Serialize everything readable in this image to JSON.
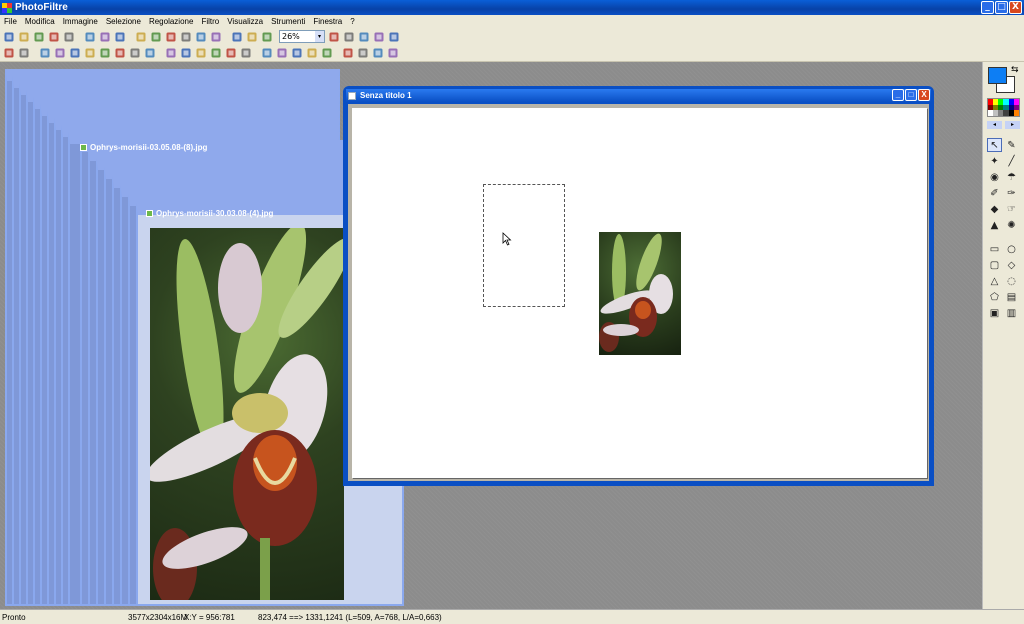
{
  "app": {
    "title": "PhotoFiltre"
  },
  "window_buttons": {
    "minimize": "_",
    "maximize": "□",
    "close": "X"
  },
  "menu": [
    "File",
    "Modifica",
    "Immagine",
    "Selezione",
    "Regolazione",
    "Filtro",
    "Visualizza",
    "Strumenti",
    "Finestra",
    "?"
  ],
  "toolbar": {
    "zoom_value": "26%",
    "zoom_arrow": "▾",
    "row1_icons": [
      "new-file-icon",
      "open-folder-icon",
      "save-icon",
      "print-icon",
      "scanner-icon",
      "undo-icon",
      "redo-icon",
      "crop-icon",
      "grayscale-icon",
      "rgb-icon",
      "duplicate-icon",
      "copy-icon",
      "paste-icon",
      "text-icon",
      "browser-icon",
      "plugin-icon",
      "image-icon",
      "zoom-in-icon",
      "zoom-out-icon",
      "fit-icon",
      "actual-size-icon",
      "fullscreen-icon"
    ],
    "row2_icons": [
      "auto-levels-icon",
      "auto-contrast-icon",
      "brightness-minus-icon",
      "brightness-plus-icon",
      "contrast-minus-icon",
      "contrast-plus-icon",
      "saturation-minus-icon",
      "saturation-plus-icon",
      "gamma-minus-icon",
      "gamma-plus-icon",
      "filter-a-icon",
      "filter-b-icon",
      "mask-icon",
      "blur-icon",
      "sharpen-icon",
      "watercolor-icon",
      "triangle-icon",
      "drop-icon",
      "palette-icon",
      "frame-icon",
      "border-icon",
      "flip-h-icon",
      "flip-v-icon",
      "rotate-icon",
      "transform-icon"
    ]
  },
  "cascade": {
    "title_a": "Ophrys-morisii-03.05.08-(8).jpg",
    "title_b": "Ophrys-morisii-30.03.08-(4).jpg"
  },
  "document": {
    "title": "Senza titolo 1"
  },
  "tools_panel": {
    "swap_glyph": "⇆",
    "palette_colors": [
      "#ff0000",
      "#ffff00",
      "#00ff00",
      "#00ffff",
      "#0000ff",
      "#ff00ff",
      "#800000",
      "#808000",
      "#008000",
      "#008080",
      "#000080",
      "#800080",
      "#ffffff",
      "#c0c0c0",
      "#808080",
      "#404040",
      "#000000",
      "#ff8000"
    ],
    "palette_prev": "◂",
    "palette_next": "▸",
    "tools_a": [
      {
        "name": "selection-tool-icon",
        "glyph": "↖"
      },
      {
        "name": "eyedropper-tool-icon",
        "glyph": "✎"
      },
      {
        "name": "magic-wand-tool-icon",
        "glyph": "✦"
      },
      {
        "name": "line-tool-icon",
        "glyph": "╱"
      },
      {
        "name": "fill-tool-icon",
        "glyph": "◉"
      },
      {
        "name": "spray-tool-icon",
        "glyph": "☂"
      },
      {
        "name": "brush-tool-icon",
        "glyph": "✐"
      },
      {
        "name": "advanced-brush-tool-icon",
        "glyph": "✑"
      },
      {
        "name": "blur-tool-icon",
        "glyph": "◆"
      },
      {
        "name": "smudge-tool-icon",
        "glyph": "☞"
      },
      {
        "name": "stamp-tool-icon",
        "glyph": "▲"
      },
      {
        "name": "clone-tool-icon",
        "glyph": "✺"
      }
    ],
    "tools_b": [
      {
        "name": "rectangle-select-icon",
        "glyph": "▭"
      },
      {
        "name": "ellipse-select-icon",
        "glyph": "○"
      },
      {
        "name": "rounded-rect-select-icon",
        "glyph": "▢"
      },
      {
        "name": "diamond-select-icon",
        "glyph": "◇"
      },
      {
        "name": "triangle-select-icon",
        "glyph": "△"
      },
      {
        "name": "lasso-select-icon",
        "glyph": "◌"
      },
      {
        "name": "polygon-select-icon",
        "glyph": "⬠"
      },
      {
        "name": "load-shape-icon",
        "glyph": "▤"
      },
      {
        "name": "selection-mode-a-icon",
        "glyph": "▣"
      },
      {
        "name": "selection-mode-b-icon",
        "glyph": "▥"
      }
    ]
  },
  "status": {
    "state": "Pronto",
    "image_info": "3577x2304x16M",
    "coords": "X:Y = 956:781",
    "selection_info": "823,474 ==> 1331,1241 (L=509, A=768, L/A=0,663)"
  }
}
